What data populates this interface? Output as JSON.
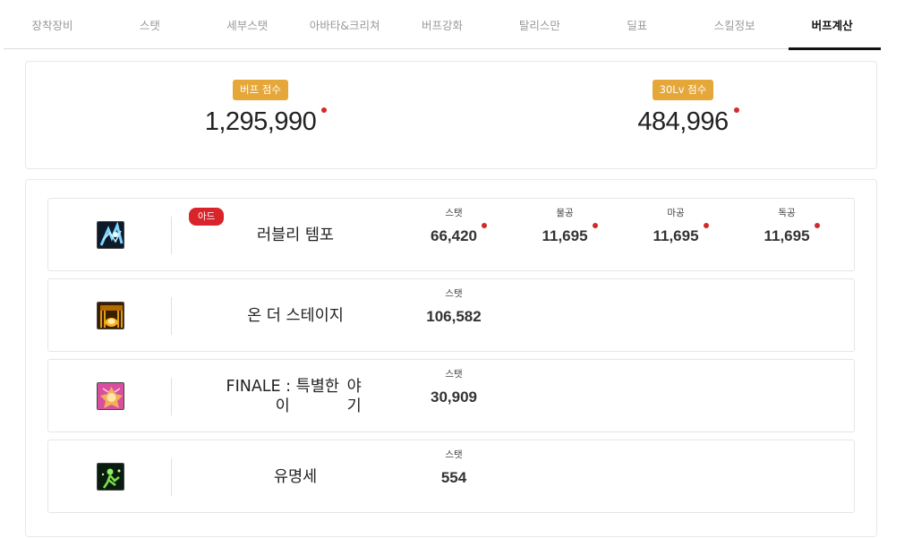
{
  "tabs": [
    {
      "label": "장착장비"
    },
    {
      "label": "스탯"
    },
    {
      "label": "세부스탯"
    },
    {
      "label": "아바타&크리쳐"
    },
    {
      "label": "버프강화"
    },
    {
      "label": "탈리스만"
    },
    {
      "label": "딜표"
    },
    {
      "label": "스킬정보"
    },
    {
      "label": "버프계산",
      "active": true
    }
  ],
  "scores": {
    "buff": {
      "label": "버프 점수",
      "value": "1,295,990"
    },
    "lv30": {
      "label": "30Lv 점수",
      "value": "484,996"
    }
  },
  "buffs": [
    {
      "name": "러블리 템포",
      "badge": "아드",
      "icon": "lovely-tempo-icon",
      "stats": [
        {
          "label": "스탯",
          "value": "66,420"
        },
        {
          "label": "물공",
          "value": "11,695"
        },
        {
          "label": "마공",
          "value": "11,695"
        },
        {
          "label": "독공",
          "value": "11,695"
        }
      ]
    },
    {
      "name": "온 더 스테이지",
      "icon": "on-the-stage-icon",
      "stats": [
        {
          "label": "스탯",
          "value": "106,582"
        }
      ]
    },
    {
      "name_line1": "FINALE : 특별한 이",
      "name_line2": "야기",
      "icon": "finale-icon",
      "stats": [
        {
          "label": "스탯",
          "value": "30,909"
        }
      ]
    },
    {
      "name": "유명세",
      "icon": "fame-icon",
      "stats": [
        {
          "label": "스탯",
          "value": "554"
        }
      ]
    }
  ],
  "colors": {
    "gold_badge": "#e5a73a",
    "red_badge": "#d9242b",
    "dot": "#d22a2a"
  }
}
